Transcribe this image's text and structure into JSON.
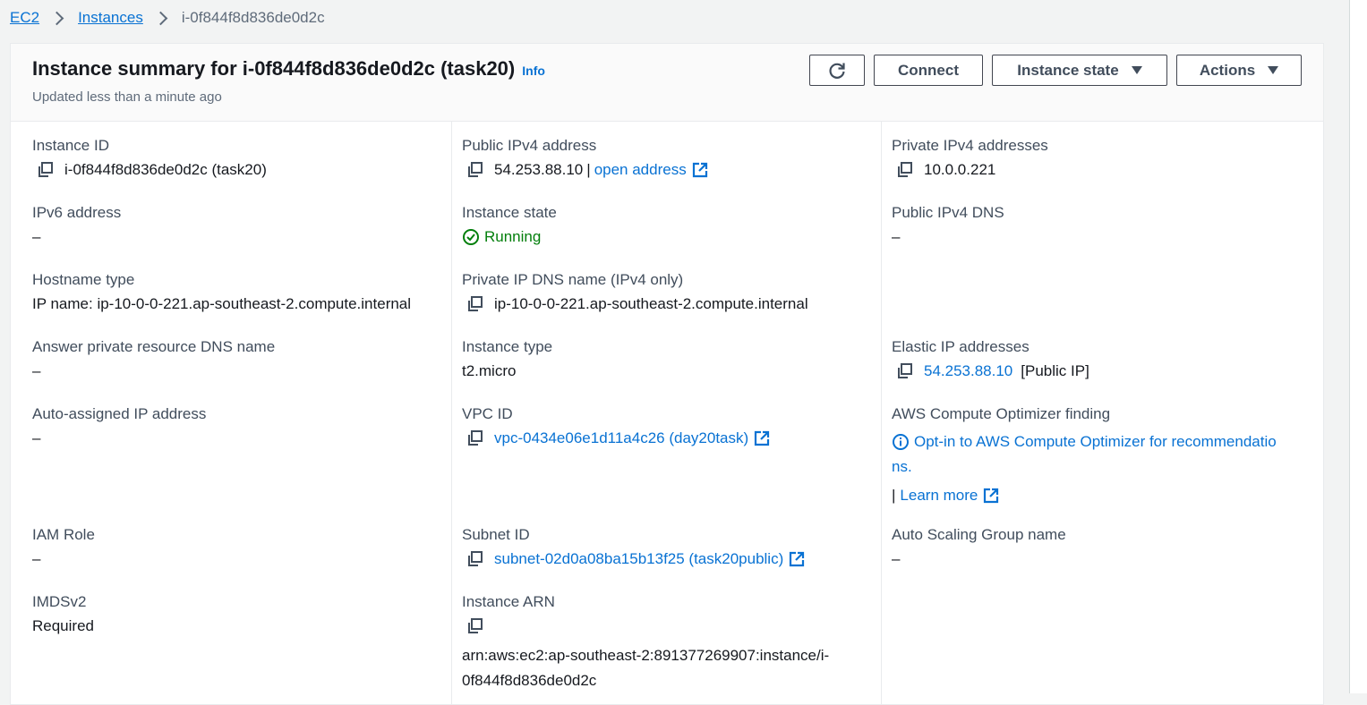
{
  "breadcrumb": {
    "root": "EC2",
    "section": "Instances",
    "current": "i-0f844f8d836de0d2c"
  },
  "header": {
    "title": "Instance summary for i-0f844f8d836de0d2c (task20)",
    "info": "Info",
    "subtitle": "Updated less than a minute ago",
    "connect_label": "Connect",
    "instance_state_label": "Instance state",
    "actions_label": "Actions"
  },
  "fields": {
    "instance_id": {
      "label": "Instance ID",
      "value": "i-0f844f8d836de0d2c (task20)"
    },
    "ipv6": {
      "label": "IPv6 address",
      "value": "–"
    },
    "hostname_type": {
      "label": "Hostname type",
      "value": "IP name: ip-10-0-0-221.ap-southeast-2.compute.internal"
    },
    "answer_dns": {
      "label": "Answer private resource DNS name",
      "value": "–"
    },
    "auto_ip": {
      "label": "Auto-assigned IP address",
      "value": "–"
    },
    "iam_role": {
      "label": "IAM Role",
      "value": "–"
    },
    "imdsv2": {
      "label": "IMDSv2",
      "value": "Required"
    },
    "public_ipv4": {
      "label": "Public IPv4 address",
      "value": "54.253.88.10",
      "separator": "|",
      "link": "open address"
    },
    "instance_state": {
      "label": "Instance state",
      "value": "Running"
    },
    "private_dns": {
      "label": "Private IP DNS name (IPv4 only)",
      "value": "ip-10-0-0-221.ap-southeast-2.compute.internal"
    },
    "instance_type": {
      "label": "Instance type",
      "value": "t2.micro"
    },
    "vpc_id": {
      "label": "VPC ID",
      "value": "vpc-0434e06e1d11a4c26 (day20task)"
    },
    "subnet_id": {
      "label": "Subnet ID",
      "value": "subnet-02d0a08ba15b13f25 (task20public)"
    },
    "instance_arn": {
      "label": "Instance ARN",
      "line1": "arn:aws:ec2:ap-southeast-2:891377269907:instance/i-",
      "line2": "0f844f8d836de0d2c"
    },
    "private_ipv4": {
      "label": "Private IPv4 addresses",
      "value": "10.0.0.221"
    },
    "public_dns": {
      "label": "Public IPv4 DNS",
      "value": "–"
    },
    "elastic_ip": {
      "label": "Elastic IP addresses",
      "value": "54.253.88.10",
      "suffix": "[Public IP]"
    },
    "optimizer": {
      "label": "AWS Compute Optimizer finding",
      "line1": "Opt-in to AWS Compute Optimizer for recommendatio",
      "line2": "ns.",
      "separator": "|",
      "learn_more": "Learn more"
    },
    "asg": {
      "label": "Auto Scaling Group name",
      "value": "–"
    }
  },
  "colors": {
    "link": "#0972d3",
    "success": "#037f0c",
    "text": "#16191f",
    "label": "#414d5c"
  },
  "icons": [
    "copy-icon",
    "external-link-icon",
    "refresh-icon",
    "success-status-icon",
    "info-icon",
    "caret-down-icon",
    "chevron-right-icon"
  ]
}
